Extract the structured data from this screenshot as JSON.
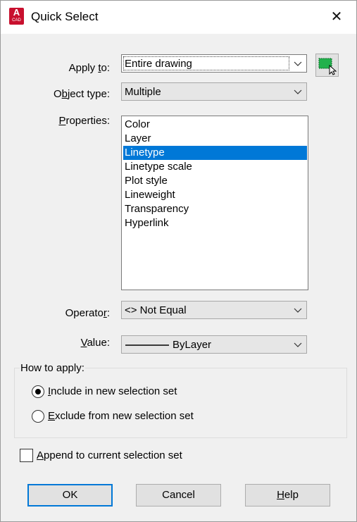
{
  "window": {
    "title": "Quick Select",
    "app_icon_letter": "A",
    "app_icon_caption": "CAD",
    "close_glyph": "✕"
  },
  "apply_to": {
    "label_pre": "Apply ",
    "label_accel": "t",
    "label_post": "o:",
    "value": "Entire drawing"
  },
  "object_type": {
    "label_pre": "O",
    "label_accel": "b",
    "label_post": "ject type:",
    "value": "Multiple"
  },
  "properties": {
    "label_accel": "P",
    "label_post": "roperties:",
    "items": [
      "Color",
      "Layer",
      "Linetype",
      "Linetype scale",
      "Plot style",
      "Lineweight",
      "Transparency",
      "Hyperlink"
    ],
    "selected": "Linetype"
  },
  "operator": {
    "label_pre": "Operato",
    "label_accel": "r",
    "label_post": ":",
    "value": "<> Not Equal"
  },
  "value": {
    "label_accel": "V",
    "label_post": "alue:",
    "value": "ByLayer"
  },
  "how_to_apply": {
    "title": "How to apply:",
    "include": {
      "accel": "I",
      "rest": "nclude in new selection set",
      "checked": true
    },
    "exclude": {
      "accel": "E",
      "rest": "xclude from new selection set",
      "checked": false
    }
  },
  "append": {
    "accel": "A",
    "rest": "ppend to current selection set",
    "checked": false
  },
  "buttons": {
    "ok": "OK",
    "cancel": "Cancel",
    "help_accel": "H",
    "help_rest": "elp"
  },
  "colors": {
    "selection": "#0078d7",
    "dialog_bg": "#f0f0f0",
    "brand_red": "#c8102e",
    "select_icon_green": "#22b14c"
  },
  "icons": {
    "select_objects": "select-objects-icon",
    "dropdown": "chevron-down-icon"
  }
}
